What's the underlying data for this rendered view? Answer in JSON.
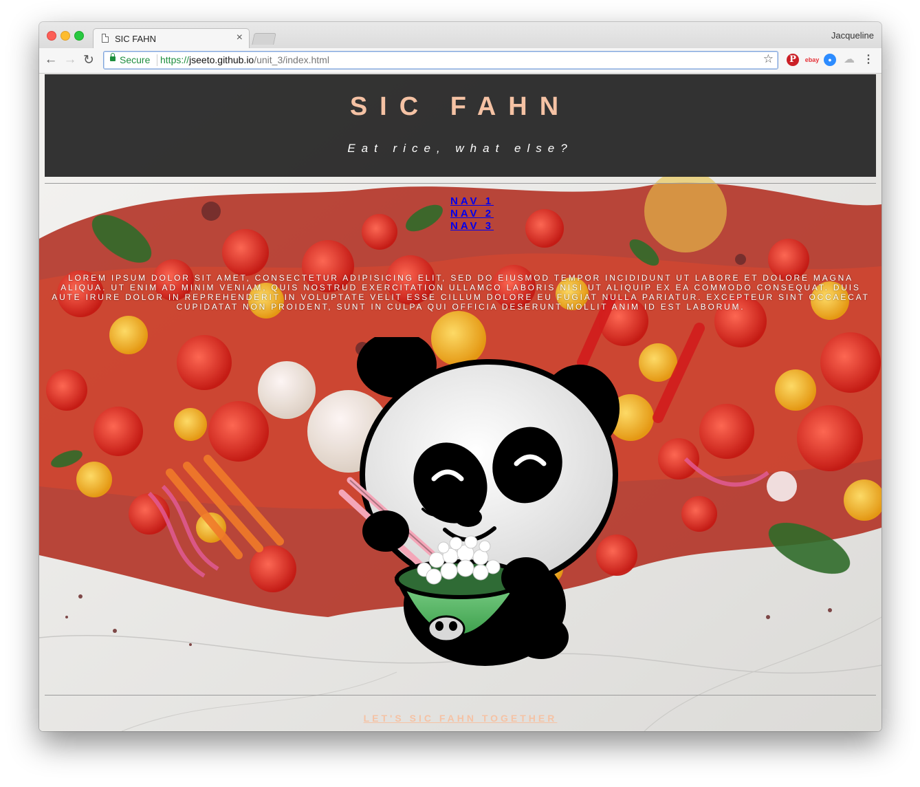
{
  "browser": {
    "tab_title": "SIC FAHN",
    "tab_close": "×",
    "profile_name": "Jacqueline",
    "back": "←",
    "forward": "→",
    "reload": "↻",
    "secure_label": "Secure",
    "url_scheme": "https://",
    "url_host": "jseeto.github.io",
    "url_path": "/unit_3/index.html",
    "bookmark_star": "☆",
    "extensions": {
      "pinterest": "P",
      "ebay": "ebay",
      "zoom": "●",
      "cloud": "☁"
    },
    "menu": "⋮"
  },
  "page": {
    "title": "SIC FAHN",
    "tagline": "Eat rice, what else?",
    "nav": [
      "NAV 1",
      "NAV 2",
      "NAV 3"
    ],
    "body_text": "LOREM IPSUM DOLOR SIT AMET, CONSECTETUR ADIPISICING ELIT, SED DO EIUSMOD TEMPOR INCIDIDUNT UT LABORE ET DOLORE MAGNA ALIQUA. UT ENIM AD MINIM VENIAM, QUIS NOSTRUD EXERCITATION ULLAMCO LABORIS NISI UT ALIQUIP EX EA COMMODO CONSEQUAT. DUIS AUTE IRURE DOLOR IN REPREHENDERIT IN VOLUPTATE VELIT ESSE CILLUM DOLORE EU FUGIAT NULLA PARIATUR. EXCEPTEUR SINT OCCAECAT CUPIDATAT NON PROIDENT, SUNT IN CULPA QUI OFFICIA DESERUNT MOLLIT ANIM ID EST LABORUM.",
    "cta": "LET'S SIC FAHN TOGETHER"
  },
  "colors": {
    "accent_peach": "#f5c2a4",
    "header_bg": "#282828",
    "link_blue": "#0000ee"
  }
}
